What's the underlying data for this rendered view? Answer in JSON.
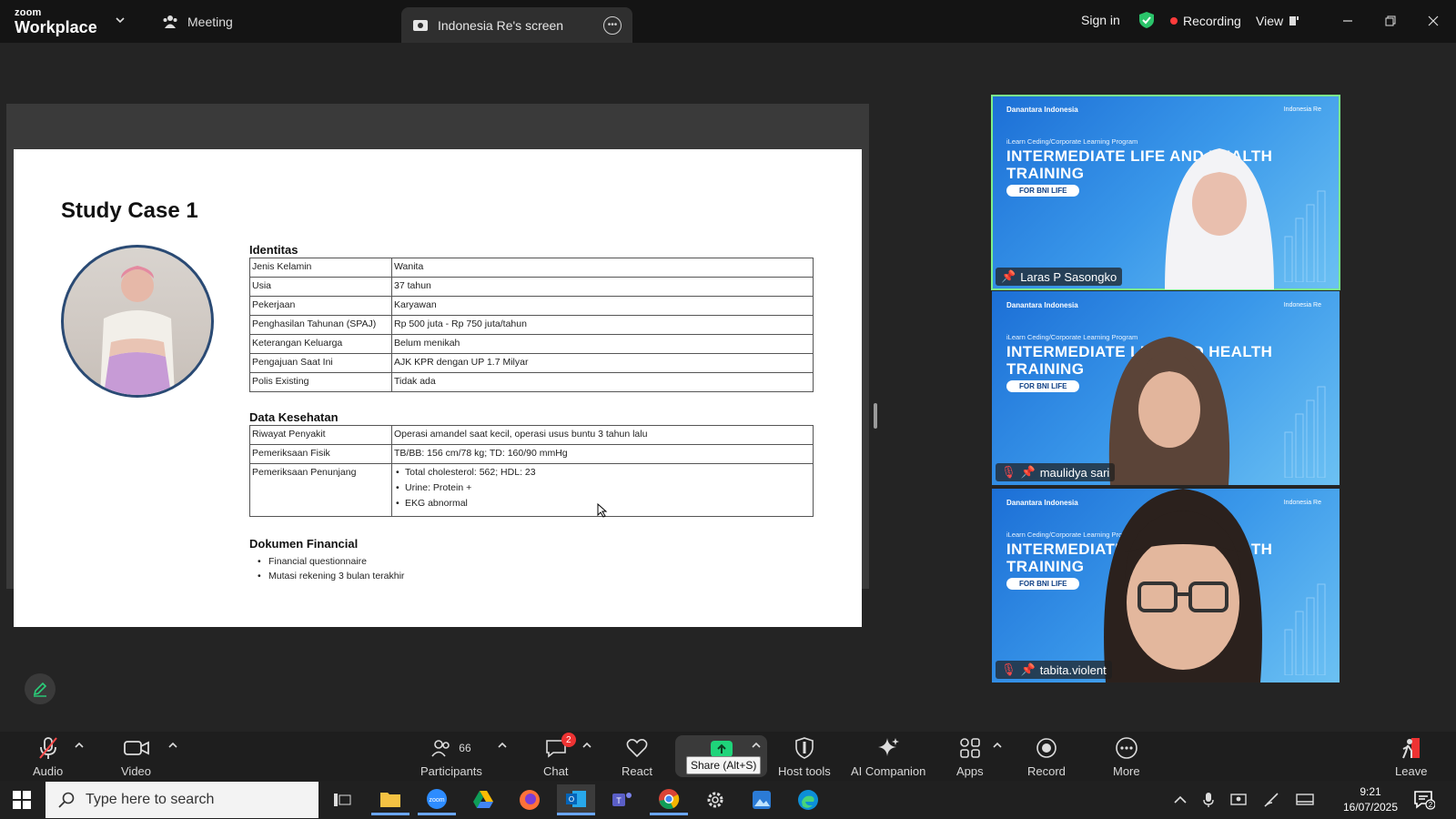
{
  "titlebar": {
    "brand_small": "zoom",
    "brand_big": "Workplace",
    "meeting_tab": "Meeting",
    "share_tab": "Indonesia Re's screen",
    "sign_in": "Sign in",
    "recording": "Recording",
    "view": "View"
  },
  "slide": {
    "title": "Study Case 1",
    "identitas_title": "Identitas",
    "identitas": [
      {
        "k": "Jenis Kelamin",
        "v": "Wanita"
      },
      {
        "k": "Usia",
        "v": "37 tahun"
      },
      {
        "k": "Pekerjaan",
        "v": "Karyawan"
      },
      {
        "k": "Penghasilan Tahunan (SPAJ)",
        "v": "Rp 500 juta - Rp 750 juta/tahun"
      },
      {
        "k": "Keterangan Keluarga",
        "v": "Belum menikah"
      },
      {
        "k": "Pengajuan Saat Ini",
        "v": "AJK KPR dengan UP 1.7 Milyar"
      },
      {
        "k": "Polis Existing",
        "v": "Tidak ada"
      }
    ],
    "kesehatan_title": "Data Kesehatan",
    "kesehatan": [
      {
        "k": "Riwayat Penyakit",
        "v": "Operasi amandel saat kecil, operasi usus buntu 3 tahun lalu"
      },
      {
        "k": "Pemeriksaan Fisik",
        "v": "TB/BB: 156 cm/78 kg; TD: 160/90 mmHg"
      }
    ],
    "penunjang_label": "Pemeriksaan Penunjang",
    "penunjang_items": [
      "Total cholesterol: 562; HDL: 23",
      "Urine: Protein +",
      "EKG abnormal"
    ],
    "financial_title": "Dokumen Financial",
    "financial_items": [
      "Financial questionnaire",
      "Mutasi rekening 3 bulan terakhir"
    ]
  },
  "tiles": {
    "logo_left": "Danantara Indonesia",
    "logo_right": "Indonesia Re",
    "program": "iLearn Ceding/Corporate Learning Program",
    "line1": "INTERMEDIATE LIFE AND HEALTH",
    "line2": "TRAINING",
    "pill": "FOR BNI LIFE",
    "names": [
      "Laras P Sasongko",
      "maulidya sari",
      "tabita.violent"
    ]
  },
  "toolbar": {
    "audio": "Audio",
    "video": "Video",
    "participants": "Participants",
    "participants_count": "66",
    "chat": "Chat",
    "chat_badge": "2",
    "react": "React",
    "share_tooltip": "Share (Alt+S)",
    "host_tools": "Host tools",
    "ai_companion": "AI Companion",
    "apps": "Apps",
    "record": "Record",
    "more": "More",
    "leave": "Leave"
  },
  "taskbar": {
    "search_placeholder": "Type here to search",
    "time": "9:21",
    "date": "16/07/2025",
    "notif_count": "2"
  },
  "colors": {
    "accent_green": "#1fd47a",
    "recording_red": "#ff3b3b",
    "active_speaker": "#7cf08a",
    "tile_blue": "#1c6fd6"
  }
}
